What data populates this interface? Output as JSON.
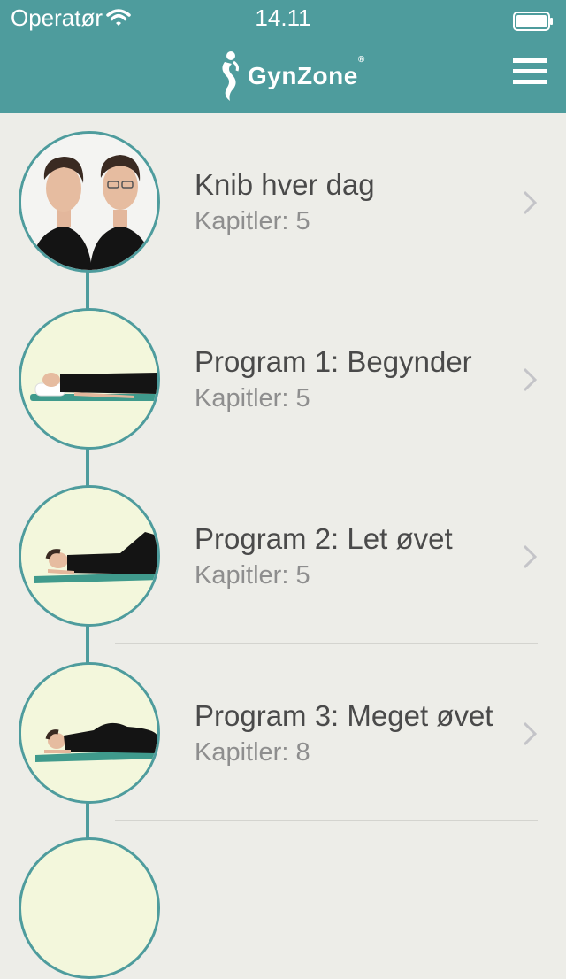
{
  "status_bar": {
    "carrier": "Operatør",
    "time": "14.11"
  },
  "nav": {
    "logo_text": "GynZone",
    "logo_mark": "®"
  },
  "colors": {
    "header_bg": "#4e9c9d",
    "list_bg": "#edede8",
    "accent": "#4e9c9d"
  },
  "programs": [
    {
      "title": "Knib hver dag",
      "chapters": "Kapitler: 5",
      "icon": "photo-two-women"
    },
    {
      "title": "Program 1: Begynder",
      "chapters": "Kapitler: 5",
      "icon": "photo-lying-back-pillow"
    },
    {
      "title": "Program 2: Let øvet",
      "chapters": "Kapitler: 5",
      "icon": "photo-lying-back-knees-up"
    },
    {
      "title": "Program 3: Meget øvet",
      "chapters": "Kapitler: 8",
      "icon": "photo-lying-side"
    }
  ]
}
